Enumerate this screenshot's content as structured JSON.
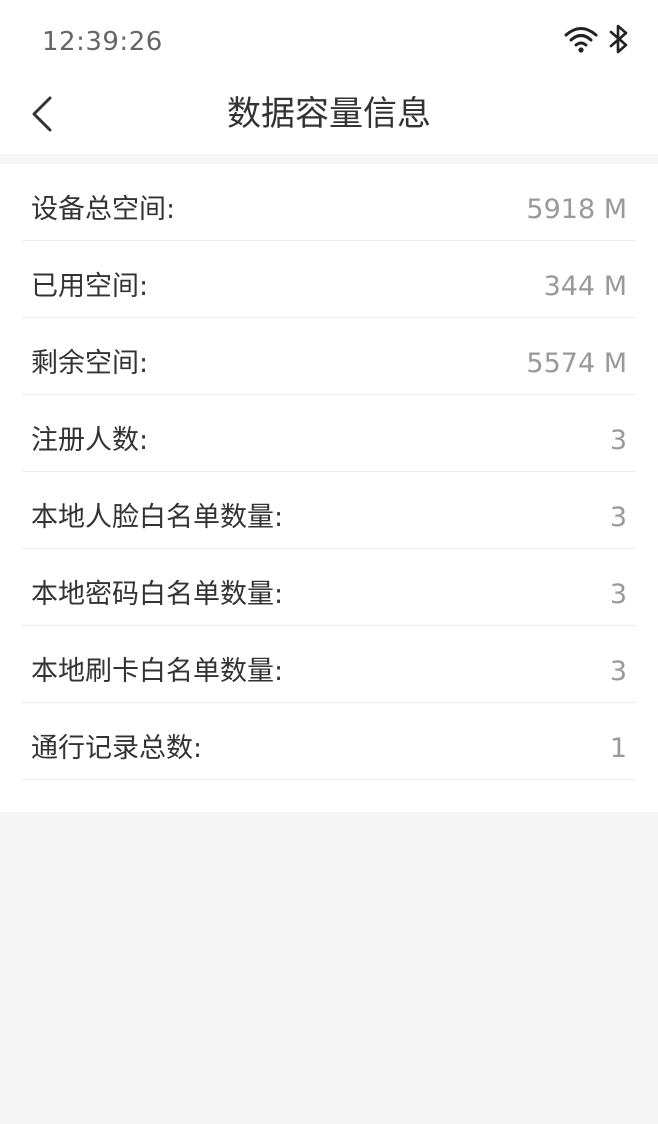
{
  "status_bar": {
    "time": "12:39:26",
    "icons": [
      "wifi-icon",
      "bluetooth-icon"
    ]
  },
  "header": {
    "title": "数据容量信息",
    "back_icon": "chevron-left-icon"
  },
  "items": [
    {
      "label": "设备总空间:",
      "value": "5918 M"
    },
    {
      "label": "已用空间:",
      "value": "344 M"
    },
    {
      "label": "剩余空间:",
      "value": "5574 M"
    },
    {
      "label": "注册人数:",
      "value": "3"
    },
    {
      "label": "本地人脸白名单数量:",
      "value": "3"
    },
    {
      "label": "本地密码白名单数量:",
      "value": "3"
    },
    {
      "label": "本地刷卡白名单数量:",
      "value": "3"
    },
    {
      "label": "通行记录总数:",
      "value": "1"
    }
  ],
  "colors": {
    "page_background": "#f5f5f5",
    "card_background": "#ffffff",
    "label_text": "#333333",
    "value_text": "#999999"
  }
}
